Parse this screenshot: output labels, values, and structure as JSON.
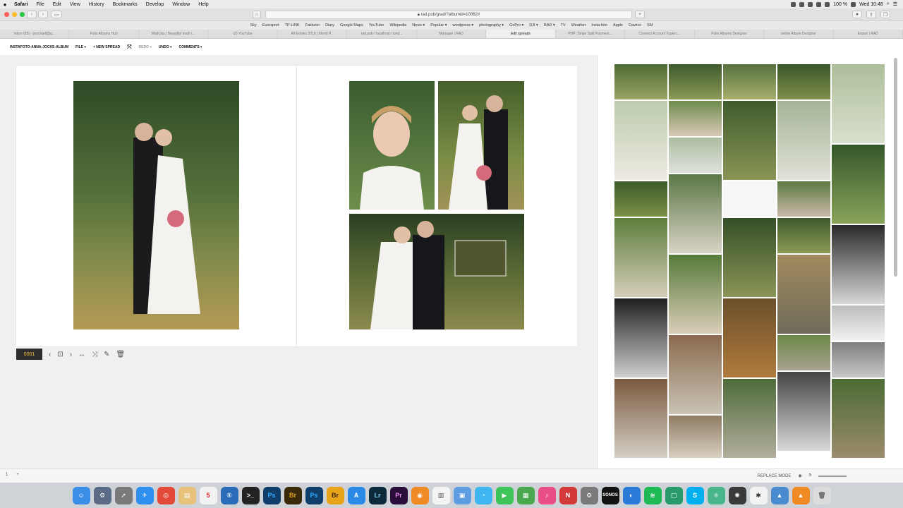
{
  "menubar": {
    "items": [
      "Safari",
      "File",
      "Edit",
      "View",
      "History",
      "Bookmarks",
      "Develop",
      "Window",
      "Help"
    ],
    "status_text": "100 %",
    "clock": "Wed 10:48"
  },
  "browser": {
    "url": "rad.pub/grad/?albumid=10062#"
  },
  "favorites": [
    "Sky",
    "Eurosport",
    "TP-LINK",
    "Fakturor",
    "Diary",
    "Google Maps",
    "YouTube",
    "Wikipedia",
    "News ▾",
    "Popular ▾",
    "wordpress ▾",
    "photography ▾",
    "GoPro ▾",
    "DJI ▾",
    "RAD ▾",
    "TV",
    "Weather",
    "Insta foto",
    "Apple",
    "Davinci",
    "SM"
  ],
  "tabs": [
    {
      "label": "Inbox (85) - post.kjell@g..."
    },
    {
      "label": "Folio Albums Hub"
    },
    {
      "label": "MathJax | Beautiful math i..."
    },
    {
      "label": "(2) YouTube"
    },
    {
      "label": "All Entries 2019 | World P..."
    },
    {
      "label": "rad.pub / localhost / lund..."
    },
    {
      "label": "Manager | RAD"
    },
    {
      "label": "Edit spreads"
    },
    {
      "label": "PHP: Stripe Split Payment..."
    },
    {
      "label": "Connect Account Types |..."
    },
    {
      "label": "Folio Albums Designer"
    },
    {
      "label": "online Album Designer"
    },
    {
      "label": "Export | RAD"
    }
  ],
  "app_toolbar": {
    "album_name": "INSTAFOTO-ANNA-JOCKE-ALBUM",
    "file_menu": "FILE ▾",
    "new_spread": "+ NEW SPREAD",
    "redo": "REDO ▾",
    "undo": "UNDO ▾",
    "comments": "COMMENTS ▾"
  },
  "spread": {
    "page_number": "0001"
  },
  "bottom": {
    "left_left": "1",
    "left_right": "+",
    "replace_mode": "REPLACE MODE"
  },
  "dock_icons": [
    "finder-icon",
    "launchpad-icon",
    "rocket-icon",
    "safari-icon",
    "chrome-icon",
    "notes-icon",
    "calendar-icon",
    "onepassword-icon",
    "terminal-icon",
    "photoshop-icon",
    "bridge-icon",
    "photoshop-icon",
    "bridge-icon",
    "appstore-icon",
    "lightroom-icon",
    "premiere-icon",
    "blender-icon",
    "textedit-icon",
    "preview-icon",
    "messages-icon",
    "facetime-icon",
    "numbers-icon",
    "itunes-icon",
    "news-icon",
    "settings-icon",
    "sonos-icon",
    "folio-icon",
    "spotify-icon",
    "files-icon",
    "skype-icon",
    "atom-icon",
    "davinci-icon",
    "wunderlist-icon",
    "drive-icon",
    "vlc-icon",
    "trash-icon"
  ],
  "colors": {
    "page_number_bg": "#2e2e2e",
    "page_number_text": "#f2c230",
    "canvas_bg": "#f0f0f0"
  }
}
